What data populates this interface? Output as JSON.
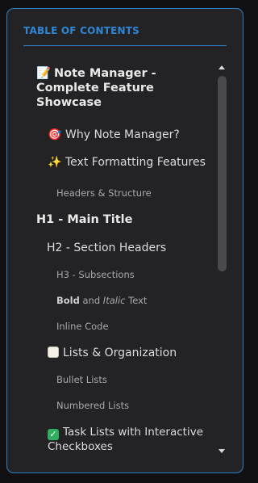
{
  "toc": {
    "header": "TABLE OF CONTENTS",
    "items": [
      {
        "icon": "📝",
        "icon_name": "memo-icon",
        "label": "Note Manager - Complete Feature Showcase",
        "level": "title"
      },
      {
        "icon": "🎯",
        "icon_name": "target-icon",
        "label": "Why Note Manager?",
        "level": 2
      },
      {
        "icon": "✨",
        "icon_name": "sparkles-icon",
        "label": "Text Formatting Features",
        "level": 2
      },
      {
        "label": "Headers & Structure",
        "level": 3
      },
      {
        "label": "H1 - Main Title",
        "level": 1
      },
      {
        "label": "H2 - Section Headers",
        "level": 2
      },
      {
        "label": "H3 - Subsections",
        "level": 3
      },
      {
        "label_bold": "Bold",
        "label_mid": " and ",
        "label_italic": "Italic",
        "label_end": " Text",
        "level": 3
      },
      {
        "label": "Inline Code",
        "level": 3
      },
      {
        "icon_name": "clipboard-icon",
        "label": "Lists & Organization",
        "level": 2
      },
      {
        "label": "Bullet Lists",
        "level": 3
      },
      {
        "label": "Numbered Lists",
        "level": 3
      },
      {
        "icon": "✓",
        "icon_name": "check-box-icon",
        "label": "Task Lists with Interactive Checkboxes",
        "level": 2
      }
    ]
  },
  "colors": {
    "accent": "#2f86d6",
    "panel_bg": "#232325",
    "page_bg": "#111113"
  }
}
